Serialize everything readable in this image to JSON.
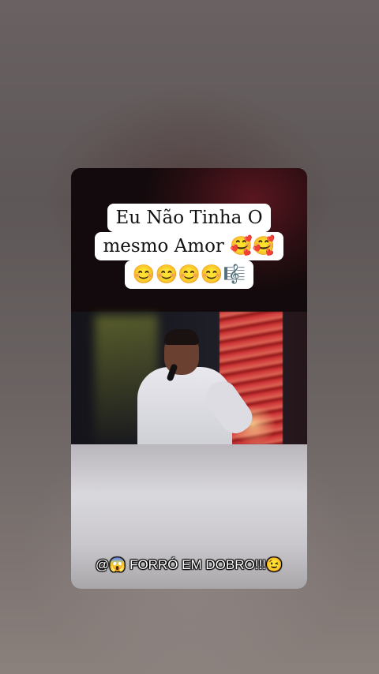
{
  "video": {
    "caption_lines": [
      "Eu Não Tinha O",
      "mesmo Amor 🥰🥰",
      "😊😊😊😊🎼"
    ],
    "footer": "@😱 FORRÓ EM DOBRO!!!😉"
  }
}
